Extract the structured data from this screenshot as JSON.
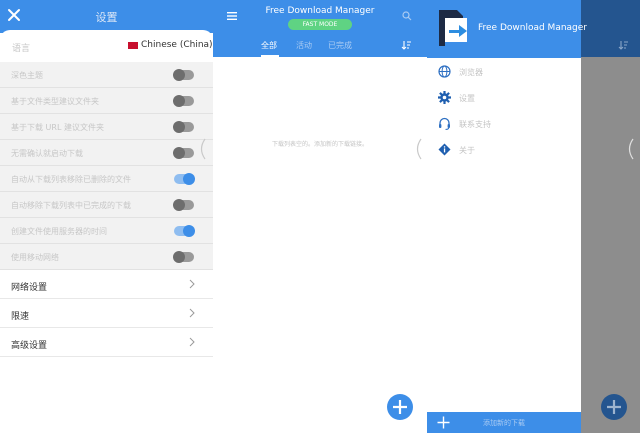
{
  "settings": {
    "title": "设置",
    "language_label": "语言",
    "language_value": "Chinese (China)",
    "toggles": [
      {
        "label": "深色主题",
        "on": false
      },
      {
        "label": "基于文件类型建议文件夹",
        "on": false
      },
      {
        "label": "基于下载 URL 建议文件夹",
        "on": false
      },
      {
        "label": "无需确认就启动下载",
        "on": false
      },
      {
        "label": "自动从下载列表移除已删除的文件",
        "on": true
      },
      {
        "label": "自动移除下载列表中已完成的下载",
        "on": false
      },
      {
        "label": "创建文件使用服务器的时间",
        "on": true
      },
      {
        "label": "使用移动网络",
        "on": false
      }
    ],
    "nav": [
      {
        "label": "网络设置"
      },
      {
        "label": "限速"
      },
      {
        "label": "高级设置"
      }
    ]
  },
  "main": {
    "app_title": "Free Download Manager",
    "mode": "FAST MODE",
    "tabs": [
      "全部",
      "活动",
      "已完成"
    ],
    "active_tab": 0,
    "empty_text": "下载列表空的。添加新的下载链接。"
  },
  "drawer": {
    "brand": "Free Download Manager",
    "items": [
      {
        "label": "浏览器",
        "icon": "globe-icon"
      },
      {
        "label": "设置",
        "icon": "gear-icon"
      },
      {
        "label": "联系支持",
        "icon": "headset-icon"
      },
      {
        "label": "关于",
        "icon": "info-icon"
      }
    ],
    "add_label": "添加新的下载"
  },
  "colors": {
    "primary": "#3d8ee8",
    "badge_green": "#5fd383",
    "overlay_bar": "#24558f"
  }
}
